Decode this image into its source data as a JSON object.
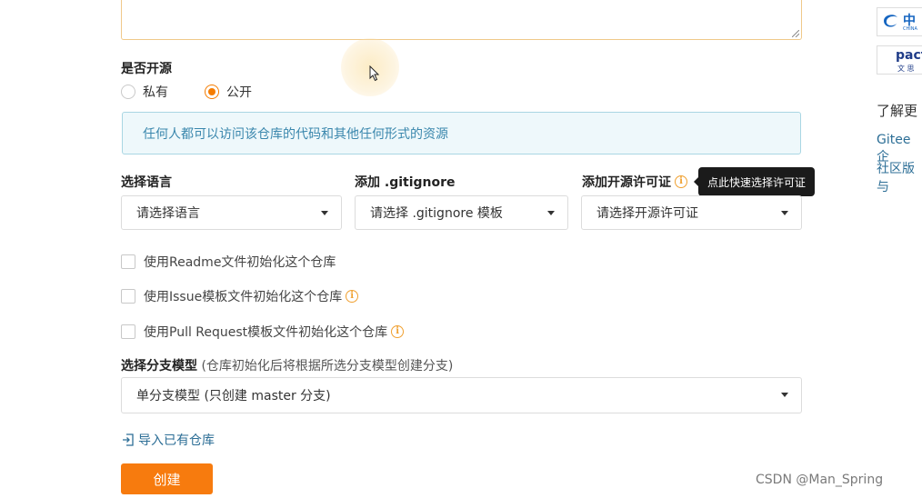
{
  "visibility": {
    "label": "是否开源",
    "options": [
      {
        "label": "私有",
        "checked": false
      },
      {
        "label": "公开",
        "checked": true
      }
    ]
  },
  "info_box": {
    "text": "任何人都可以访问该仓库的代码和其他任何形式的资源"
  },
  "language": {
    "label": "选择语言",
    "value": "请选择语言"
  },
  "gitignore": {
    "label": "添加 .gitignore",
    "value": "请选择 .gitignore 模板"
  },
  "license": {
    "label": "添加开源许可证",
    "value": "请选择开源许可证",
    "tooltip": "点此快速选择许可证"
  },
  "checkboxes": [
    {
      "label": "使用Readme文件初始化这个仓库",
      "checked": false,
      "has_info": false
    },
    {
      "label": "使用Issue模板文件初始化这个仓库",
      "checked": false,
      "has_info": true
    },
    {
      "label": "使用Pull Request模板文件初始化这个仓库",
      "checked": false,
      "has_info": true
    }
  ],
  "branch_model": {
    "label": "选择分支模型",
    "hint": "(仓库初始化后将根据所选分支模型创建分支)",
    "value": "单分支模型 (只创建 master 分支)"
  },
  "import_link": "导入已有仓库",
  "create_button": "创建",
  "sidebar": {
    "logo1_text": "中",
    "logo1_sub": "CHINA",
    "logo2_text": "pact",
    "logo2_sub": "文 思",
    "heading": "了解更",
    "links": [
      "Gitee 企",
      "社区版与"
    ]
  },
  "watermark": "CSDN @Man_Spring",
  "colors": {
    "accent": "#f77b0e",
    "info_text": "#3a87ad",
    "link": "#2c6e96"
  }
}
